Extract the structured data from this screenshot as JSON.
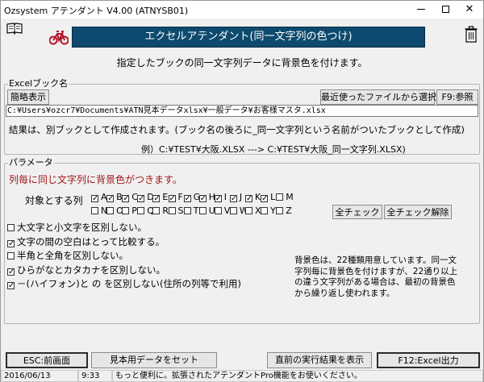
{
  "window": {
    "title": "Ozsystem アテンダント V4.00 (ATNYSB01)"
  },
  "banner": {
    "title": "エクセルアテンダント(同一文字列の色つけ)"
  },
  "description": "指定したブックの同一文字列データに背景色を付けます。",
  "excel_book": {
    "group_label": "Excelブック名",
    "simple_display_label": "簡略表示",
    "recent_files_label": "最近使ったファイルから選択",
    "browse_label": "F9:参照",
    "path": "C:¥Users¥ozcr7¥Documents¥ATN見本データxlsx¥一般データ¥お客様マスタ.xlsx",
    "note": "結果は、別ブックとして作成されます。(ブック名の後ろに_同一文字列という名前がついたブックとして作成)",
    "example": "例）C:¥TEST¥大阪.XLSX ---> C:¥TEST¥大阪_同一文字列.XLSX)"
  },
  "params": {
    "group_label": "パラメータ",
    "caption": "列毎に同じ文字列に背景色がつきます。",
    "target_columns_label": "対象とする列",
    "columns": [
      {
        "letter": "A",
        "checked": true
      },
      {
        "letter": "B",
        "checked": true
      },
      {
        "letter": "C",
        "checked": true
      },
      {
        "letter": "D",
        "checked": true
      },
      {
        "letter": "E",
        "checked": true
      },
      {
        "letter": "F",
        "checked": true
      },
      {
        "letter": "G",
        "checked": true
      },
      {
        "letter": "H",
        "checked": true
      },
      {
        "letter": "I",
        "checked": true
      },
      {
        "letter": "J",
        "checked": true
      },
      {
        "letter": "K",
        "checked": true
      },
      {
        "letter": "L",
        "checked": true
      },
      {
        "letter": "M",
        "checked": false
      },
      {
        "letter": "N",
        "checked": false
      },
      {
        "letter": "O",
        "checked": false
      },
      {
        "letter": "P",
        "checked": false
      },
      {
        "letter": "Q",
        "checked": false
      },
      {
        "letter": "R",
        "checked": false
      },
      {
        "letter": "S",
        "checked": false
      },
      {
        "letter": "T",
        "checked": false
      },
      {
        "letter": "U",
        "checked": false
      },
      {
        "letter": "V",
        "checked": false
      },
      {
        "letter": "W",
        "checked": false
      },
      {
        "letter": "X",
        "checked": false
      },
      {
        "letter": "Y",
        "checked": false
      },
      {
        "letter": "Z",
        "checked": false
      }
    ],
    "check_all_label": "全チェック",
    "uncheck_all_label": "全チェック解除",
    "options": [
      {
        "label": "大文字と小文字を区別しない。",
        "checked": false
      },
      {
        "label": "文字の間の空白はとって比較する。",
        "checked": true
      },
      {
        "label": "半角と全角を区別しない。",
        "checked": false
      },
      {
        "label": "ひらがなとカタカナを区別しない。",
        "checked": true
      },
      {
        "label": "－(ハイフォン)と の を区別しない(住所の列等で利用)",
        "checked": true
      }
    ],
    "note_lines": [
      "背景色は、22種類用意しています。同一文",
      "字列毎に背景色を付けますが、22通り以上",
      "の違う文字列がある場合は、最初の背景色",
      "から繰り返し使われます。"
    ]
  },
  "buttons": {
    "esc_label": "ESC:前画面",
    "sample_label": "見本用データをセット",
    "show_last_label": "直前の実行結果を表示",
    "f12_label": "F12:Excel出力"
  },
  "status": {
    "date": "2016/06/13",
    "time": "9:33",
    "message": "もっと便利に。拡張されたアテンダントPro機能をお使いください。"
  },
  "colors": {
    "banner": "#0e4a6f",
    "caption": "#a01818",
    "bike": "#b3132b"
  },
  "icons": {
    "book": "book-icon",
    "bike": "bicycle-icon",
    "trash": "trash-icon"
  }
}
